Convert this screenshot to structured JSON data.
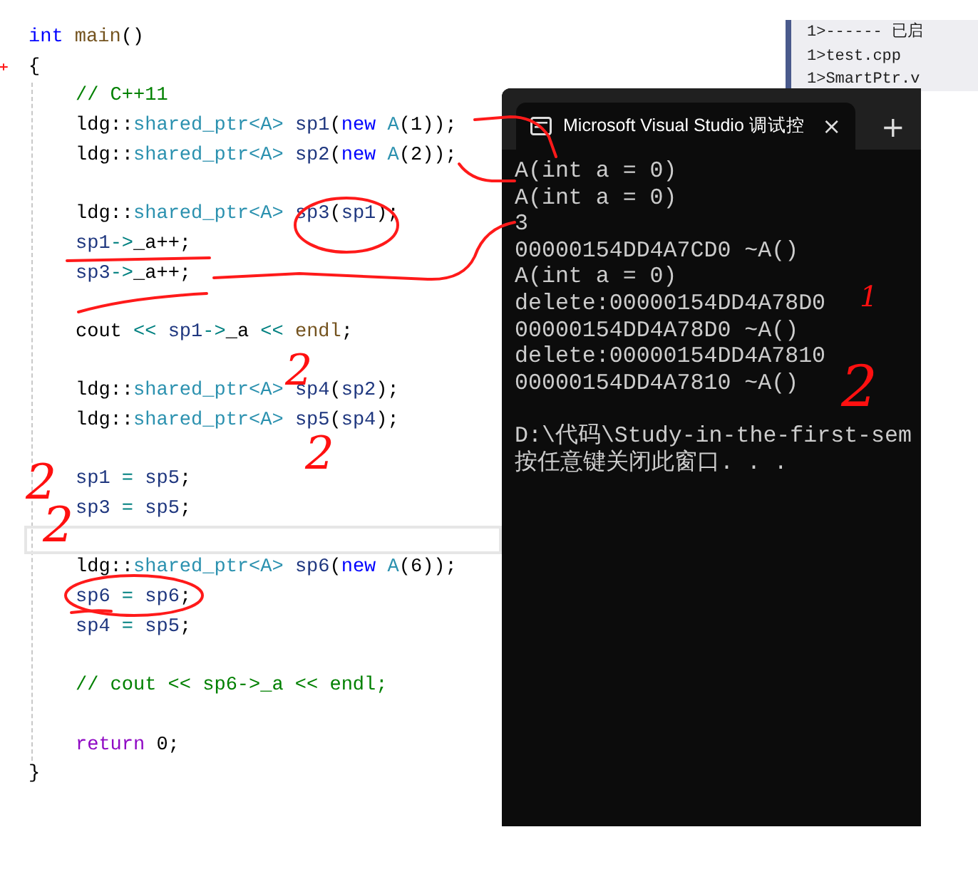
{
  "editor": {
    "lines": [
      {
        "kind": "code",
        "tokens": [
          {
            "kind": "keyword",
            "text": "int "
          },
          {
            "kind": "function",
            "text": "main"
          },
          {
            "kind": "plain",
            "text": "()"
          }
        ]
      },
      {
        "kind": "code",
        "tokens": [
          {
            "kind": "plain",
            "text": "{"
          }
        ]
      },
      {
        "kind": "block",
        "children": [
          {
            "kind": "code",
            "tokens": [
              {
                "kind": "comment",
                "text": "// C++11"
              }
            ]
          },
          {
            "kind": "code",
            "tokens": [
              {
                "kind": "plain",
                "text": "ldg::"
              },
              {
                "kind": "type",
                "text": "shared_ptr<A> "
              },
              {
                "kind": "variable",
                "text": "sp1"
              },
              {
                "kind": "plain",
                "text": "("
              },
              {
                "kind": "keyword",
                "text": "new "
              },
              {
                "kind": "type",
                "text": "A"
              },
              {
                "kind": "plain",
                "text": "(1));"
              }
            ]
          },
          {
            "kind": "code",
            "tokens": [
              {
                "kind": "plain",
                "text": "ldg::"
              },
              {
                "kind": "type",
                "text": "shared_ptr<A> "
              },
              {
                "kind": "variable",
                "text": "sp2"
              },
              {
                "kind": "plain",
                "text": "("
              },
              {
                "kind": "keyword",
                "text": "new "
              },
              {
                "kind": "type",
                "text": "A"
              },
              {
                "kind": "plain",
                "text": "(2));"
              }
            ]
          },
          {
            "kind": "blank"
          },
          {
            "kind": "code",
            "tokens": [
              {
                "kind": "plain",
                "text": "ldg::"
              },
              {
                "kind": "type",
                "text": "shared_ptr<A> "
              },
              {
                "kind": "variable",
                "text": "sp3"
              },
              {
                "kind": "plain",
                "text": "("
              },
              {
                "kind": "variable",
                "text": "sp1"
              },
              {
                "kind": "plain",
                "text": ");"
              }
            ]
          },
          {
            "kind": "code",
            "tokens": [
              {
                "kind": "variable",
                "text": "sp1"
              },
              {
                "kind": "operator",
                "text": "->"
              },
              {
                "kind": "plain",
                "text": "_a++;"
              }
            ]
          },
          {
            "kind": "code",
            "tokens": [
              {
                "kind": "variable",
                "text": "sp3"
              },
              {
                "kind": "operator",
                "text": "->"
              },
              {
                "kind": "plain",
                "text": "_a++;"
              }
            ]
          },
          {
            "kind": "blank"
          },
          {
            "kind": "code",
            "tokens": [
              {
                "kind": "plain",
                "text": "cout "
              },
              {
                "kind": "operator",
                "text": "<< "
              },
              {
                "kind": "variable",
                "text": "sp1"
              },
              {
                "kind": "operator",
                "text": "->"
              },
              {
                "kind": "plain",
                "text": "_a "
              },
              {
                "kind": "operator",
                "text": "<< "
              },
              {
                "kind": "function",
                "text": "endl"
              },
              {
                "kind": "plain",
                "text": ";"
              }
            ]
          },
          {
            "kind": "blank"
          },
          {
            "kind": "code",
            "tokens": [
              {
                "kind": "plain",
                "text": "ldg::"
              },
              {
                "kind": "type",
                "text": "shared_ptr<A> "
              },
              {
                "kind": "variable",
                "text": "sp4"
              },
              {
                "kind": "plain",
                "text": "("
              },
              {
                "kind": "variable",
                "text": "sp2"
              },
              {
                "kind": "plain",
                "text": ");"
              }
            ]
          },
          {
            "kind": "code",
            "tokens": [
              {
                "kind": "plain",
                "text": "ldg::"
              },
              {
                "kind": "type",
                "text": "shared_ptr<A> "
              },
              {
                "kind": "variable",
                "text": "sp5"
              },
              {
                "kind": "plain",
                "text": "("
              },
              {
                "kind": "variable",
                "text": "sp4"
              },
              {
                "kind": "plain",
                "text": ");"
              }
            ]
          },
          {
            "kind": "blank"
          },
          {
            "kind": "code",
            "tokens": [
              {
                "kind": "variable",
                "text": "sp1"
              },
              {
                "kind": "operator",
                "text": " = "
              },
              {
                "kind": "variable",
                "text": "sp5"
              },
              {
                "kind": "plain",
                "text": ";"
              }
            ]
          },
          {
            "kind": "code",
            "tokens": [
              {
                "kind": "variable",
                "text": "sp3"
              },
              {
                "kind": "operator",
                "text": " = "
              },
              {
                "kind": "variable",
                "text": "sp5"
              },
              {
                "kind": "plain",
                "text": ";"
              }
            ]
          },
          {
            "kind": "cursor_line"
          },
          {
            "kind": "code",
            "tokens": [
              {
                "kind": "plain",
                "text": "ldg::"
              },
              {
                "kind": "type",
                "text": "shared_ptr<A> "
              },
              {
                "kind": "variable",
                "text": "sp6"
              },
              {
                "kind": "plain",
                "text": "("
              },
              {
                "kind": "keyword",
                "text": "new "
              },
              {
                "kind": "type",
                "text": "A"
              },
              {
                "kind": "plain",
                "text": "(6));"
              }
            ]
          },
          {
            "kind": "code",
            "tokens": [
              {
                "kind": "variable",
                "text": "sp6"
              },
              {
                "kind": "operator",
                "text": " = "
              },
              {
                "kind": "variable",
                "text": "sp6"
              },
              {
                "kind": "plain",
                "text": ";"
              }
            ]
          },
          {
            "kind": "code",
            "tokens": [
              {
                "kind": "variable",
                "text": "sp4"
              },
              {
                "kind": "operator",
                "text": " = "
              },
              {
                "kind": "variable",
                "text": "sp5"
              },
              {
                "kind": "plain",
                "text": ";"
              }
            ]
          },
          {
            "kind": "blank"
          },
          {
            "kind": "code",
            "tokens": [
              {
                "kind": "comment",
                "text": "// cout << sp6->_a << endl;"
              }
            ]
          },
          {
            "kind": "blank"
          },
          {
            "kind": "code",
            "tokens": [
              {
                "kind": "control",
                "text": "return"
              },
              {
                "kind": "plain",
                "text": " 0;"
              }
            ]
          }
        ]
      },
      {
        "kind": "code",
        "tokens": [
          {
            "kind": "plain",
            "text": "}"
          }
        ]
      }
    ]
  },
  "output_pane": {
    "lines": [
      "1>------ 已启",
      "1>test.cpp",
      "1>SmartPtr.v"
    ]
  },
  "console": {
    "tab_title": "Microsoft Visual Studio 调试控",
    "close": "×",
    "new_tab": "+",
    "lines": [
      "A(int a = 0)",
      "A(int a = 0)",
      "3",
      "00000154DD4A7CD0 ~A()",
      "A(int a = 0)",
      "delete:00000154DD4A78D0",
      "00000154DD4A78D0 ~A()",
      "delete:00000154DD4A7810",
      "00000154DD4A7810 ~A()"
    ],
    "prompt_lines": [
      "D:\\代码\\Study-in-the-first-sem",
      "按任意键关闭此窗口. . ."
    ]
  },
  "annotations": {
    "notes": [
      {
        "text": "2"
      },
      {
        "text": "2"
      },
      {
        "text": "2"
      },
      {
        "text": "2"
      },
      {
        "text": "1"
      },
      {
        "text": "2"
      }
    ]
  }
}
